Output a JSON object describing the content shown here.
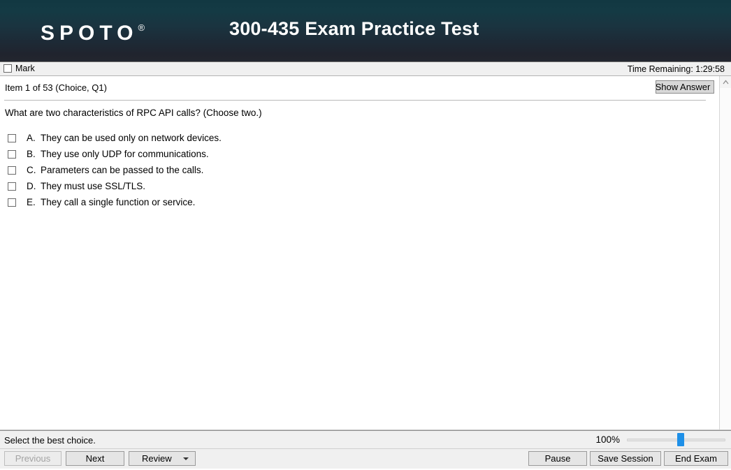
{
  "header": {
    "logo_text": "SPOTO",
    "logo_mark": "®",
    "title": "300-435 Exam Practice Test",
    "gradient_top": "#123842",
    "gradient_bottom": "#23262f"
  },
  "markbar": {
    "mark_label": "Mark",
    "time_remaining": "Time Remaining: 1:29:58"
  },
  "item": {
    "item_label": "Item 1 of 53  (Choice, Q1)",
    "show_answer_label": "Show Answer",
    "question": "What are two characteristics of RPC API calls? (Choose two.)",
    "options": [
      {
        "letter": "A.",
        "text": "They can be used only on network devices.",
        "checked": false
      },
      {
        "letter": "B.",
        "text": "They use only UDP for communications.",
        "checked": false
      },
      {
        "letter": "C.",
        "text": "Parameters can be passed to the calls.",
        "checked": false
      },
      {
        "letter": "D.",
        "text": "They must use SSL/TLS.",
        "checked": false
      },
      {
        "letter": "E.",
        "text": "They call a single function or service.",
        "checked": false
      }
    ]
  },
  "scrollbar": {
    "up_arrow_icon": "chevron-up-icon"
  },
  "statusbar": {
    "status_text": "Select the best choice.",
    "zoom_percent": "100%",
    "zoom_accent": "#1e90e8"
  },
  "buttons": {
    "previous": "Previous",
    "next": "Next",
    "review": "Review",
    "review_caret_icon": "caret-down-icon",
    "pause": "Pause",
    "save_session": "Save Session",
    "end_exam": "End Exam"
  }
}
